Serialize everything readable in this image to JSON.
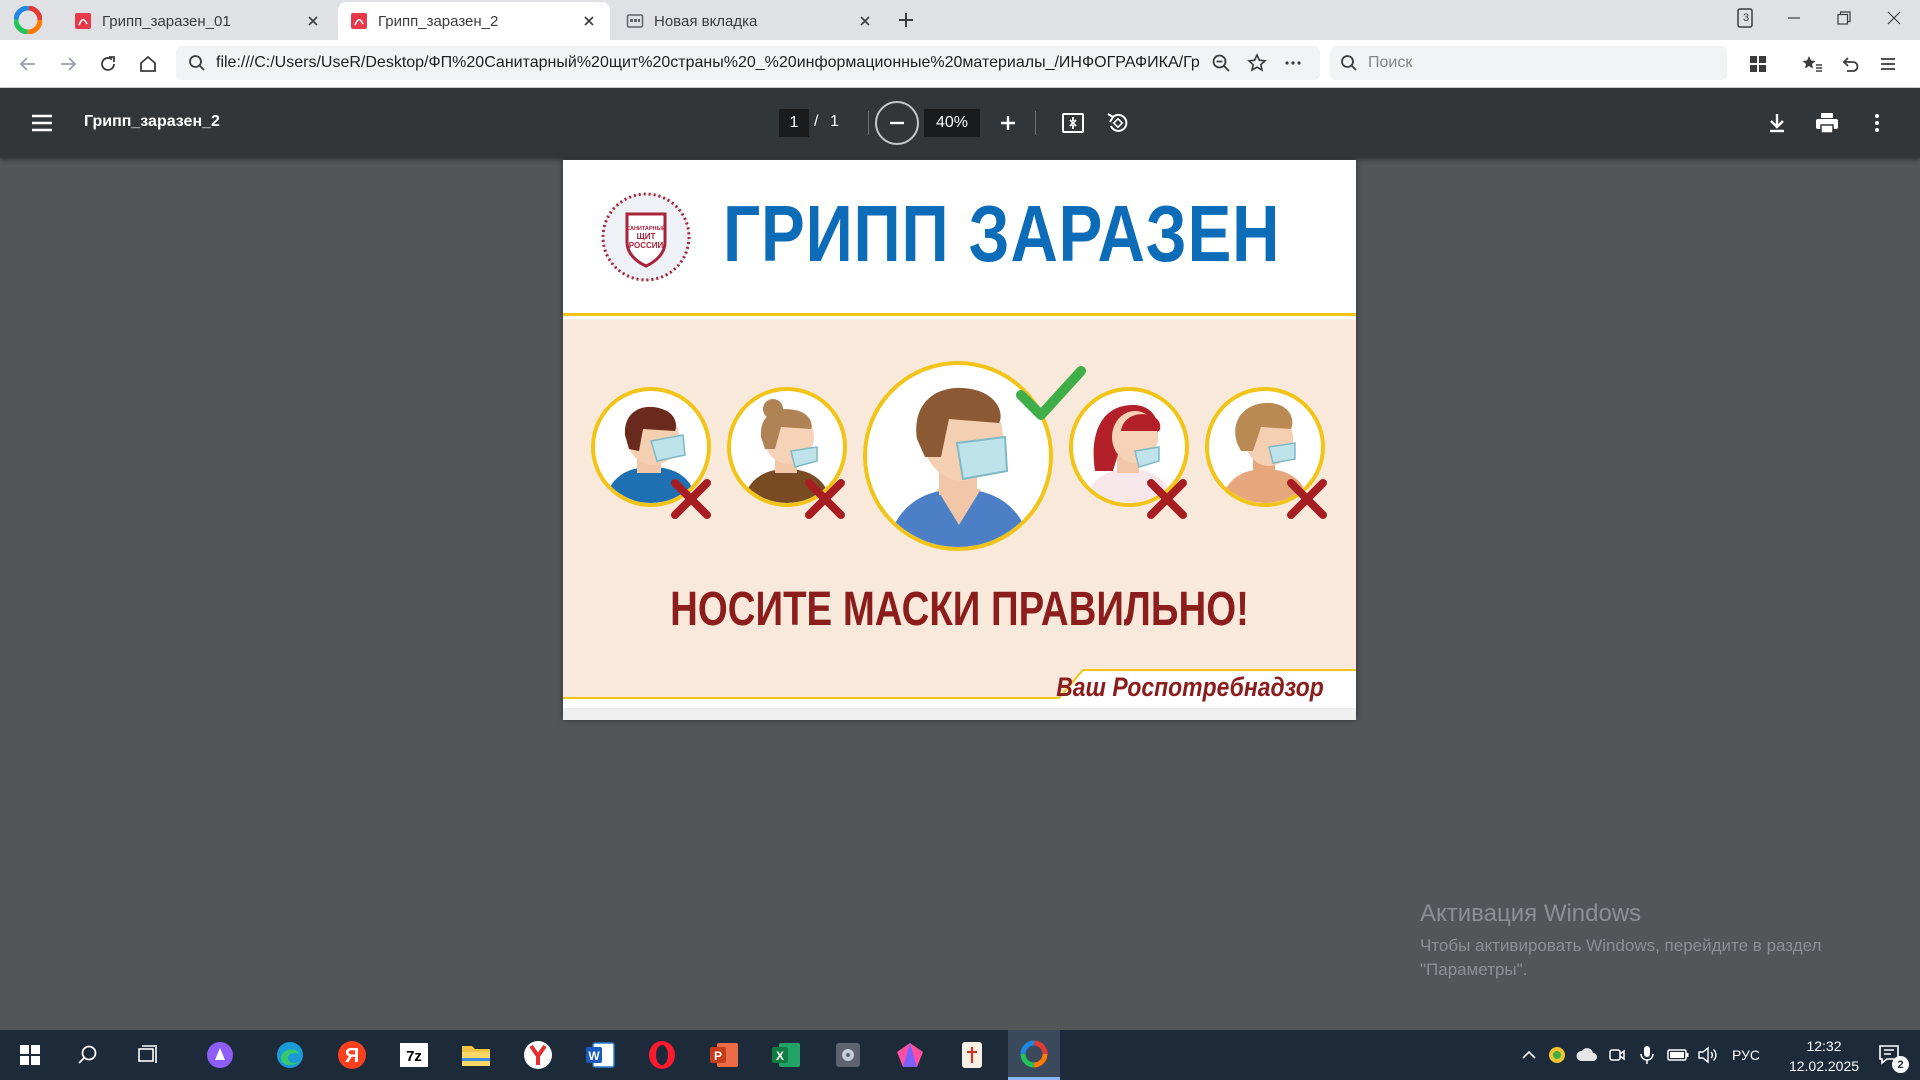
{
  "browser": {
    "tabs": [
      {
        "title": "Грипп_заразен_01",
        "active": false
      },
      {
        "title": "Грипп_заразен_2",
        "active": true
      },
      {
        "title": "Новая вкладка",
        "active": false
      }
    ],
    "tab_counter": "3",
    "address_url": "file:///C:/Users/UseR/Desktop/ФП%20Санитарный%20щит%20страны%20_%20информационные%20материалы_/ИНФОГРАФИКА/Грипп_заразен_2.pdf",
    "search_placeholder": "Поиск"
  },
  "pdf_viewer": {
    "file_title": "Грипп_заразен_2",
    "current_page": "1",
    "page_separator": "/",
    "total_pages": "1",
    "zoom_level": "40%"
  },
  "poster": {
    "emblem_text": [
      "САНИТАРНЫЙ",
      "ЩИТ",
      "РОССИИ"
    ],
    "title": "ГРИПП ЗАРАЗЕН",
    "slogan": "НОСИТЕ МАСКИ ПРАВИЛЬНО!",
    "signature": "Ваш Роспотребнадзор",
    "colors": {
      "title_blue": "#0c6cb7",
      "accent_yellow": "#f2c418",
      "dark_red": "#8c1d1d",
      "beige": "#f9e9da"
    }
  },
  "windows_activation": {
    "title": "Активация Windows",
    "line1": "Чтобы активировать Windows, перейдите в раздел",
    "line2": "\"Параметры\"."
  },
  "taskbar": {
    "apps": [
      "start-icon",
      "search-icon",
      "task-view-icon",
      "alice-icon",
      "edge-icon",
      "yandex-icon",
      "7zip-icon",
      "file-explorer-icon",
      "yandex-browser-icon",
      "word-icon",
      "opera-icon",
      "powerpoint-icon",
      "excel-icon",
      "media-icon",
      "gem-app-icon",
      "mahjong-icon",
      "browser-active-icon"
    ],
    "language": "РУС",
    "time": "12:32",
    "date": "12.02.2025",
    "notification_count": "2"
  }
}
